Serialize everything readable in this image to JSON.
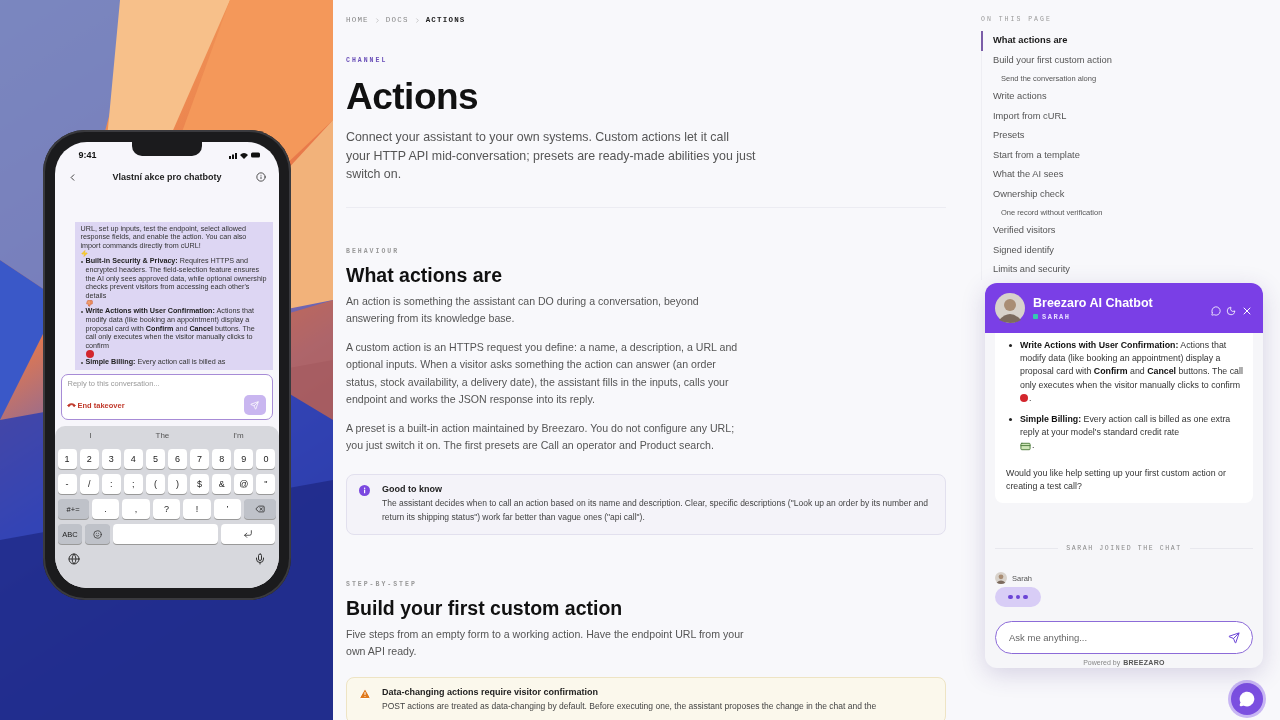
{
  "phone": {
    "status_time": "9:41",
    "title": "Vlastní akce pro chatboty",
    "message": {
      "lead": {
        "text": "URL, set up inputs, test the endpoint, select allowed response fields, and enable the action. You can also import commands directly from cURL!",
        "emoji": true
      },
      "items": [
        {
          "text": "**Built-in Security & Privacy:** Requires HTTPS and encrypted headers. The field-selection feature ensures the AI only sees approved data, while optional ownership checks prevent visitors from accessing each other's details",
          "emoji": true
        },
        {
          "text": "**Write Actions with User Confirmation:** Actions that modify data (like booking an appointment) display a proposal card with **Confirm** and **Cancel** buttons. The call only executes when the visitor manually clicks to confirm",
          "emoji": true
        },
        {
          "text": "**Simple Billing:** Every action call is billed as",
          "emoji": false
        }
      ]
    },
    "reply": {
      "placeholder": "Reply to this conversation...",
      "end_button": "End takeover"
    },
    "keyboard": {
      "suggestions": [
        "I",
        "The",
        "I'm"
      ],
      "digits": [
        "1",
        "2",
        "3",
        "4",
        "5",
        "6",
        "7",
        "8",
        "9",
        "0"
      ],
      "symbols": [
        "-",
        "/",
        ":",
        ";",
        "(",
        ")",
        "$",
        "&",
        "@",
        "\""
      ],
      "mode_key": "#+=",
      "punctuation": [
        ".",
        ",",
        "?",
        "!",
        "’"
      ],
      "abc_key": "ABC"
    }
  },
  "breadcrumb": [
    {
      "label": "HOME",
      "current": false
    },
    {
      "label": "DOCS",
      "current": false
    },
    {
      "label": "ACTIONS",
      "current": true
    }
  ],
  "page": {
    "eyebrow": "CHANNEL",
    "title": "Actions",
    "intro": "Connect your assistant to your own systems. Custom actions let it call your HTTP API mid-conversation; presets are ready-made abilities you just switch on."
  },
  "sections": [
    {
      "eyebrow": "BEHAVIOUR",
      "title": "What actions are",
      "paragraphs": [
        "An action is something the assistant can DO during a conversation, beyond answering from its knowledge base.",
        "A custom action is an HTTPS request you define: a name, a description, a URL and optional inputs. When a visitor asks something the action can answer (an order status, stock availability, a delivery date), the assistant fills in the inputs, calls your endpoint and works the JSON response into its reply.",
        "A preset is a built-in action maintained by Breezaro. You do not configure any URL; you just switch it on. The first presets are Call an operator and Product search."
      ],
      "callout": {
        "kind": "info",
        "title": "Good to know",
        "text": "The assistant decides when to call an action based on its name and description. Clear, specific descriptions (\"Look up an order by its number and return its shipping status\") work far better than vague ones (\"api call\")."
      }
    },
    {
      "eyebrow": "STEP-BY-STEP",
      "title": "Build your first custom action",
      "paragraphs": [
        "Five steps from an empty form to a working action. Have the endpoint URL from your own API ready."
      ],
      "callout": {
        "kind": "warning",
        "title": "Data-changing actions require visitor confirmation",
        "text": "POST actions are treated as data-changing by default. Before executing one, the assistant proposes the change in the chat and the"
      }
    }
  ],
  "toc": {
    "heading": "ON THIS PAGE",
    "items": [
      {
        "label": "What actions are",
        "selected": true
      },
      {
        "label": "Build your first custom action",
        "selected": false,
        "children": [
          {
            "label": "Send the conversation along",
            "selected": false
          }
        ]
      },
      {
        "label": "Write actions",
        "selected": false
      },
      {
        "label": "Import from cURL",
        "selected": false
      },
      {
        "label": "Presets",
        "selected": false
      },
      {
        "label": "Start from a template",
        "selected": false
      },
      {
        "label": "What the AI sees",
        "selected": false
      },
      {
        "label": "Ownership check",
        "selected": false,
        "children": [
          {
            "label": "One record without verification",
            "selected": false
          }
        ]
      },
      {
        "label": "Verified visitors",
        "selected": false
      },
      {
        "label": "Signed identify",
        "selected": false
      },
      {
        "label": "Limits and security",
        "selected": false
      }
    ]
  },
  "chat": {
    "title": "Breezaro AI Chatbot",
    "agent": {
      "name": "SARAH",
      "online": true
    },
    "message": {
      "items": [
        {
          "text": "**Write Actions with User Confirmation:** Actions that modify data (like booking an appointment) display a proposal card with **Confirm** and **Cancel** buttons. The call only executes when the visitor manually clicks to confirm",
          "emoji": true,
          "end": "."
        },
        {
          "text": "**Simple Billing:** Every action call is billed as one extra reply at your model's standard credit rate",
          "emoji": true,
          "end": "."
        }
      ],
      "question": "Would you like help setting up your first custom action or creating a test call?"
    },
    "event": "SARAH JOINED THE CHAT",
    "typing": {
      "name": "Sarah"
    },
    "input": {
      "placeholder": "Ask me anything..."
    },
    "powered_by": "Powered by",
    "brand": "BREEZARO"
  }
}
